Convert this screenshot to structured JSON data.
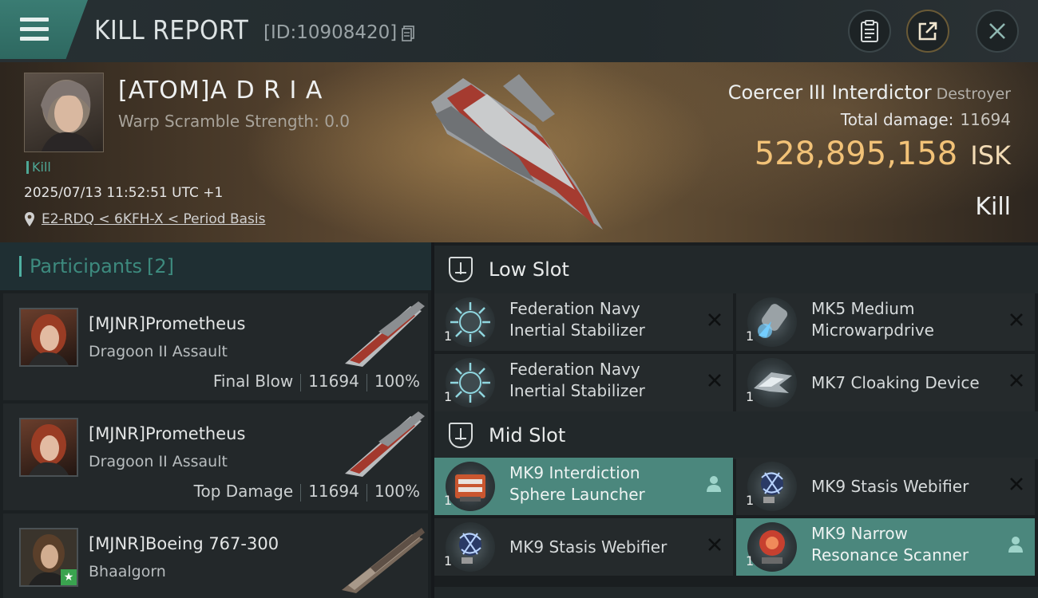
{
  "header": {
    "title": "KILL REPORT",
    "report_id": "[ID:10908420]",
    "menu_icon": "hamburger-icon",
    "buttons": [
      {
        "name": "clipboard-icon"
      },
      {
        "name": "share-icon"
      },
      {
        "name": "close-icon"
      }
    ]
  },
  "victim": {
    "name": "[ATOM]A D R I A",
    "warp_scramble": "Warp Scramble Strength: 0.0",
    "tag": "Kill",
    "datetime": "2025/07/13 11:52:51 UTC +1",
    "location": "E2-RDQ < 6KFH-X < Period Basis",
    "ship_name": "Coercer III Interdictor",
    "ship_class": "Destroyer",
    "total_damage_label": "Total damage:",
    "total_damage": "11694",
    "isk_value": "528,895,158",
    "isk_unit": "ISK",
    "result": "Kill"
  },
  "participants": {
    "title": "Participants",
    "count": "[2]",
    "rows": [
      {
        "name": "[MJNR]Prometheus",
        "ship": "Dragoon II Assault",
        "role": "Final Blow",
        "damage": "11694",
        "percent": "100%"
      },
      {
        "name": "[MJNR]Prometheus",
        "ship": "Dragoon II Assault",
        "role": "Top Damage",
        "damage": "11694",
        "percent": "100%"
      },
      {
        "name": "[MJNR]Boeing 767-300",
        "ship": "Bhaalgorn",
        "role": "",
        "damage": "",
        "percent": ""
      }
    ]
  },
  "fittings": {
    "low_slot_title": "Low Slot",
    "mid_slot_title": "Mid Slot",
    "low": [
      {
        "name": "Federation Navy Inertial Stabilizer",
        "qty": "1",
        "status": "destroyed"
      },
      {
        "name": "MK5 Medium Microwarpdrive",
        "qty": "1",
        "status": "destroyed"
      },
      {
        "name": "Federation Navy Inertial Stabilizer",
        "qty": "1",
        "status": "destroyed"
      },
      {
        "name": "MK7 Cloaking Device",
        "qty": "1",
        "status": "destroyed"
      }
    ],
    "mid": [
      {
        "name": "MK9 Interdiction Sphere Launcher",
        "qty": "1",
        "status": "dropped"
      },
      {
        "name": "MK9 Stasis Webifier",
        "qty": "1",
        "status": "destroyed"
      },
      {
        "name": "MK9 Stasis Webifier",
        "qty": "1",
        "status": "destroyed"
      },
      {
        "name": "MK9 Narrow Resonance Scanner",
        "qty": "1",
        "status": "dropped"
      }
    ]
  },
  "colors": {
    "accent": "#4b877d",
    "isk": "#f2c277",
    "teal_text": "#3d8a7e"
  }
}
